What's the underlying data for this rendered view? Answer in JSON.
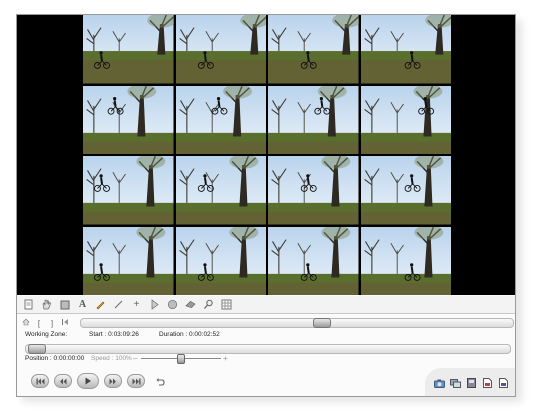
{
  "window": {
    "title": ""
  },
  "viewer": {
    "frames": [
      {
        "label": "frame-1"
      },
      {
        "label": "frame-2"
      },
      {
        "label": "frame-3"
      },
      {
        "label": "frame-4"
      },
      {
        "label": "frame-5"
      },
      {
        "label": "frame-6"
      },
      {
        "label": "frame-7"
      },
      {
        "label": "frame-8"
      },
      {
        "label": "frame-9"
      },
      {
        "label": "frame-10"
      },
      {
        "label": "frame-11"
      },
      {
        "label": "frame-12"
      },
      {
        "label": "frame-13"
      },
      {
        "label": "frame-14"
      },
      {
        "label": "frame-15"
      },
      {
        "label": "frame-16"
      }
    ]
  },
  "toolbar": {
    "items": [
      {
        "name": "new-document-icon"
      },
      {
        "name": "hand-tool-icon"
      },
      {
        "name": "rectangle-tool-icon"
      },
      {
        "name": "text-tool-icon",
        "glyph": "A"
      },
      {
        "name": "pen-tool-icon"
      },
      {
        "name": "line-tool-icon"
      },
      {
        "name": "plus-tool-icon",
        "glyph": "+"
      },
      {
        "name": "arrow-tool-icon"
      },
      {
        "name": "circle-tool-icon"
      },
      {
        "name": "eraser-tool-icon"
      },
      {
        "name": "zoom-tool-icon"
      },
      {
        "name": "grid-tool-icon"
      }
    ]
  },
  "working_zone": {
    "label": "Working Zone:",
    "start": "Start : 0:03:09:26",
    "duration": "Duration : 0:00:02:52",
    "markers": [
      "[",
      "]"
    ]
  },
  "position": {
    "label": "Position : 0:00:00:00",
    "speed": "Speed : 100%",
    "zoom_minus": "–",
    "zoom_plus": "+"
  },
  "playback": {
    "buttons": [
      "first-frame",
      "previous-frame",
      "play",
      "next-frame",
      "last-frame",
      "loop"
    ]
  },
  "colors": {
    "accent": "#6a6a6a",
    "viewer_bg": "#000000"
  }
}
